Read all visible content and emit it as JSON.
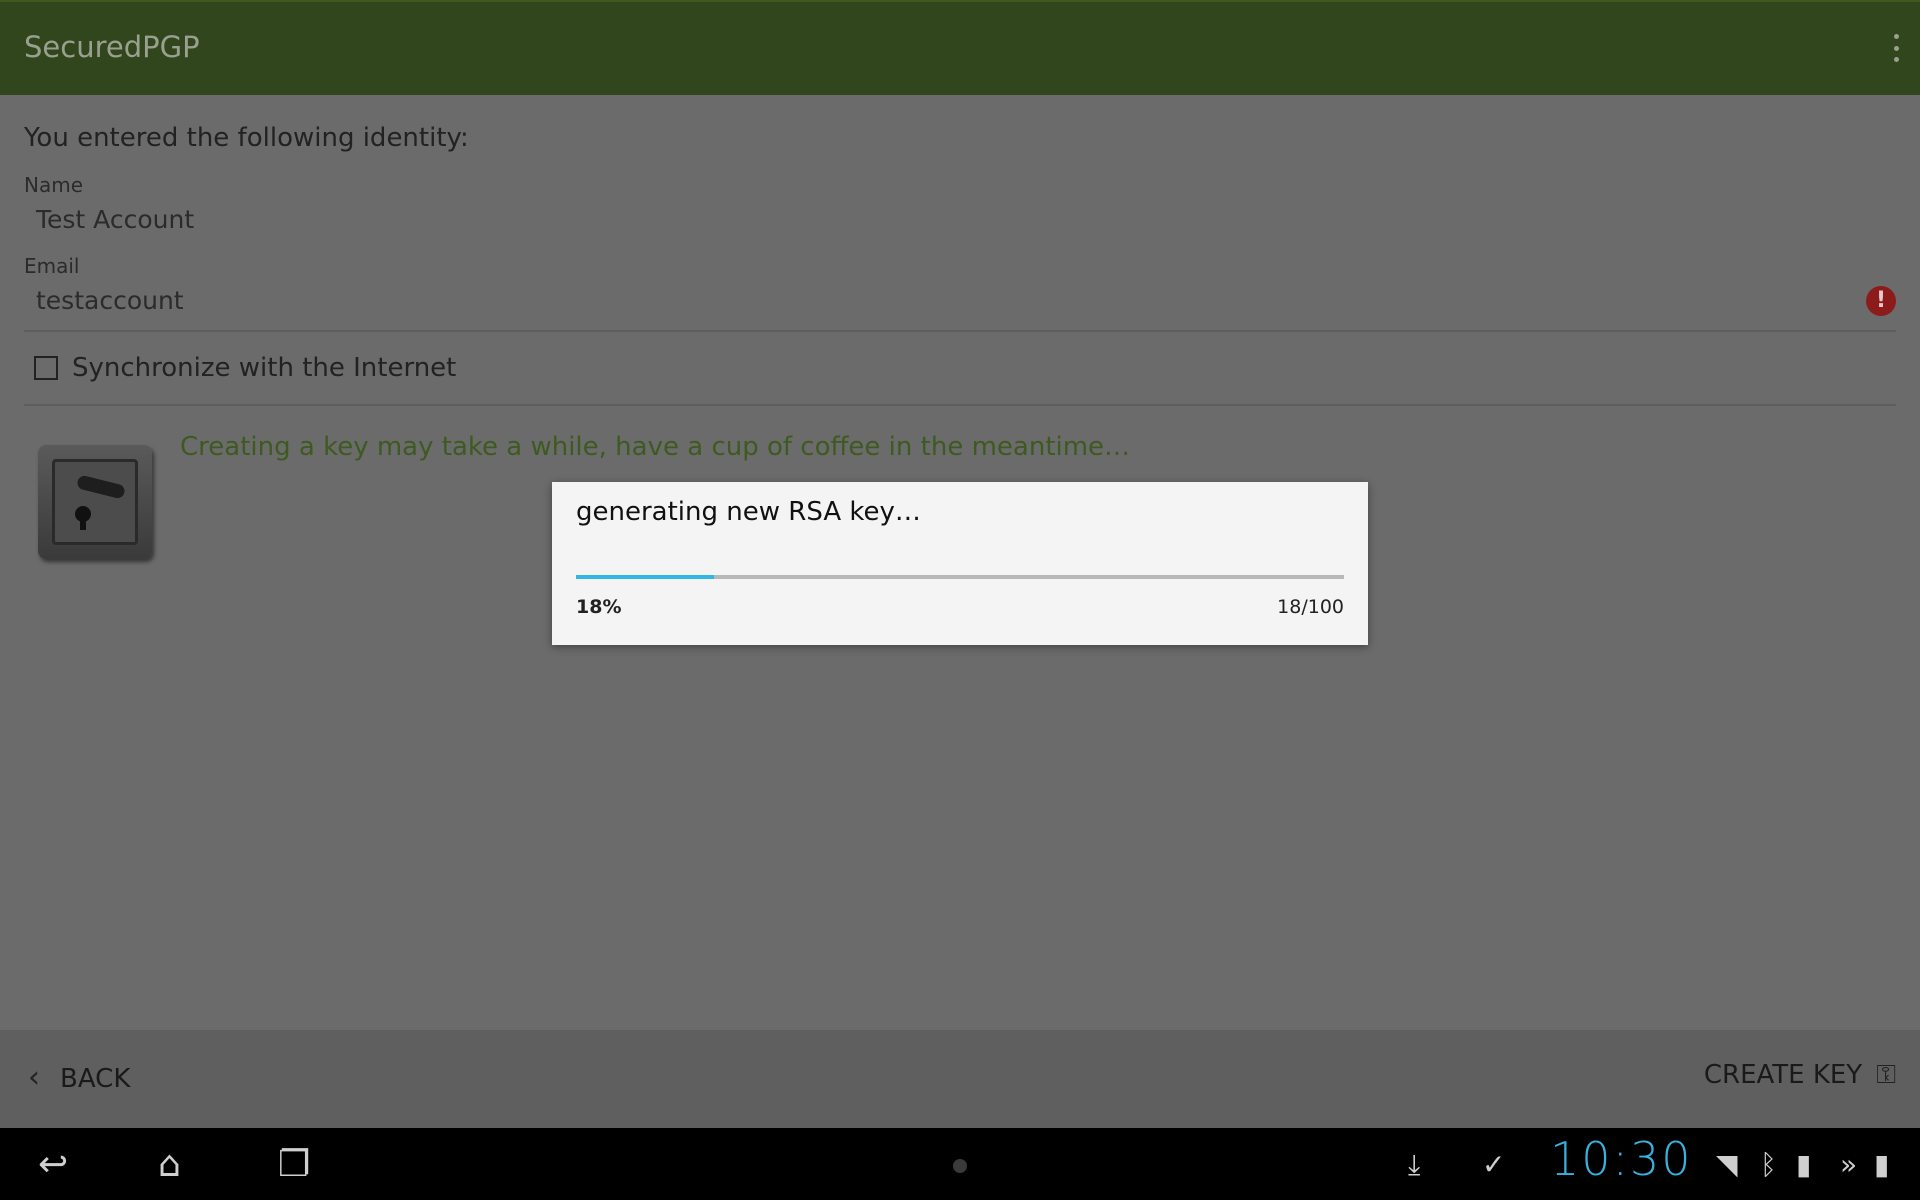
{
  "app": {
    "title": "SecuredPGP"
  },
  "identity": {
    "heading": "You entered the following identity:",
    "name_label": "Name",
    "name_value": "Test Account",
    "email_label": "Email",
    "email_value": "testaccount",
    "error_icon": "error-icon"
  },
  "sync": {
    "label": "Synchronize with the Internet",
    "checked": false
  },
  "hint": "Creating a key may take a while, have a cup of coffee in the meantime…",
  "bottom": {
    "back_label": "BACK",
    "create_label": "CREATE KEY"
  },
  "dialog": {
    "message": "generating new RSA key…",
    "progress_fraction": 0.18,
    "percent_text": "18%",
    "count_text": "18/100",
    "progress_color": "#33b5e5"
  },
  "status": {
    "clock": "10:30"
  },
  "colors": {
    "actionbar": "#31461c",
    "hint": "#3f5a20",
    "accent": "#33b5e5"
  }
}
